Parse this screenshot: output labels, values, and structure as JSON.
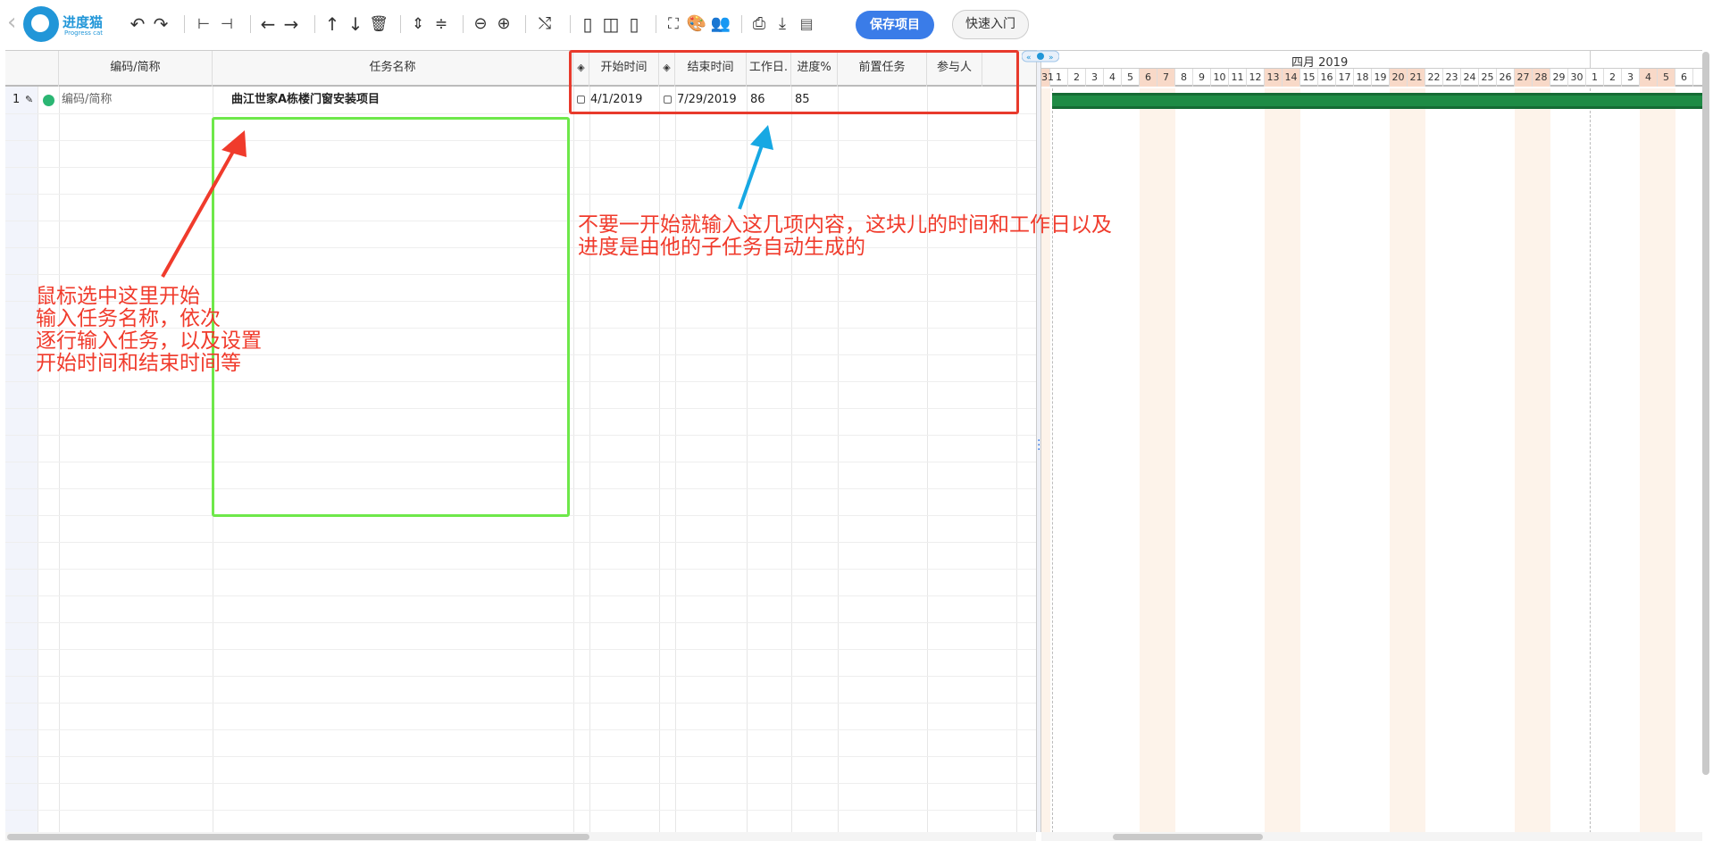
{
  "app": {
    "logo_text": "进度猫",
    "logo_sub": "Progress cat"
  },
  "toolbar": {
    "save_label": "保存项目",
    "quick_label": "快速入门"
  },
  "grid": {
    "columns": {
      "code": "编码/简称",
      "name": "任务名称",
      "start": "开始时间",
      "end": "结束时间",
      "workdays": "工作日.",
      "progress": "进度%",
      "predecessor": "前置任务",
      "assignee": "参与人"
    },
    "rows": [
      {
        "num": "1",
        "code": "编码/简称",
        "name": "曲江世家A栋楼门窗安装项目",
        "start": "4/1/2019",
        "end": "7/29/2019",
        "workdays": "86",
        "progress": "85"
      }
    ]
  },
  "gantt": {
    "month": "四月 2019",
    "prev_day": "31",
    "days": [
      "1",
      "2",
      "3",
      "4",
      "5",
      "6",
      "7",
      "8",
      "9",
      "10",
      "11",
      "12",
      "13",
      "14",
      "15",
      "16",
      "17",
      "18",
      "19",
      "20",
      "21",
      "22",
      "23",
      "24",
      "25",
      "26",
      "27",
      "28",
      "29",
      "30"
    ],
    "next_days": [
      "1",
      "2",
      "3",
      "4",
      "5",
      "6"
    ],
    "weekend_days": [
      "6",
      "7",
      "13",
      "14",
      "20",
      "21",
      "27",
      "28"
    ]
  },
  "annotations": {
    "left_note": "鼠标选中这里开始\n输入任务名称，依次\n逐行输入任务，以及设置\n开始时间和结束时间等",
    "right_note": "不要一开始就输入这几项内容，这块儿的时间和工作日以及\n进度是由他的子任务自动生成的"
  }
}
